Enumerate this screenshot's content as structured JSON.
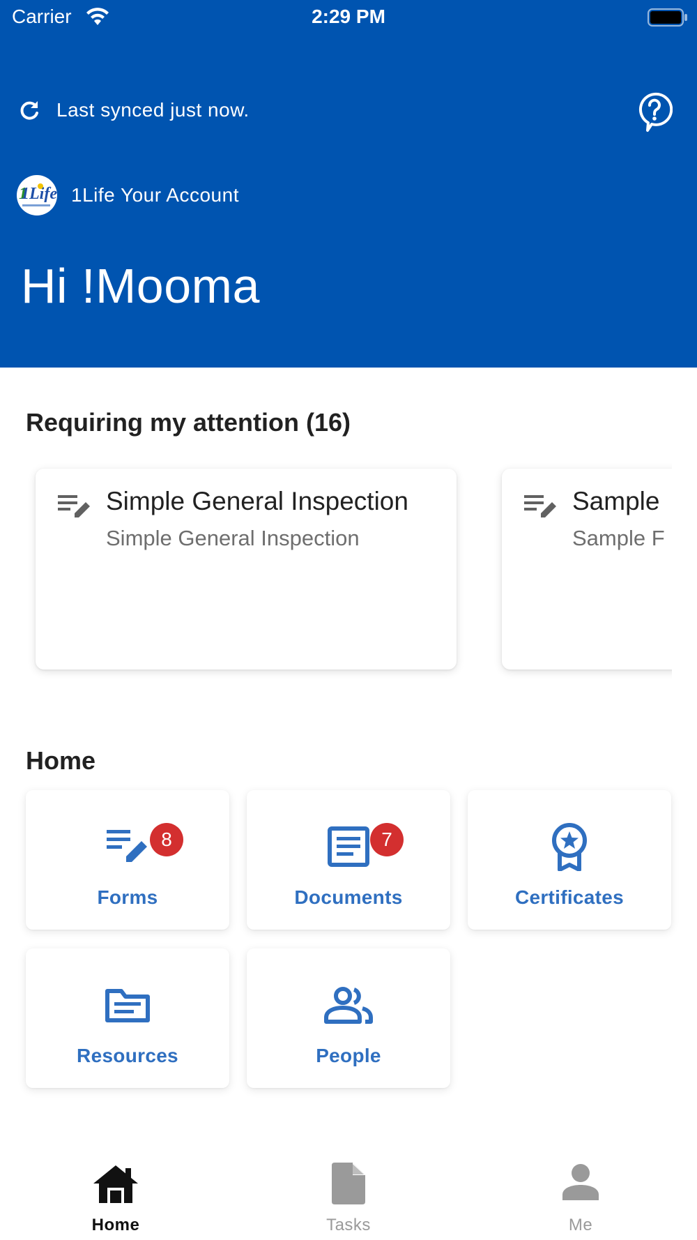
{
  "status_bar": {
    "carrier": "Carrier",
    "time": "2:29 PM"
  },
  "header": {
    "sync_text": "Last synced just now.",
    "account_logo_text": "1Life",
    "account_name": "1Life Your Account",
    "greeting": "Hi !Mooma",
    "background_color": "#0054B0",
    "icons": {
      "sync": "refresh-icon",
      "help": "help-bubble-icon"
    }
  },
  "attention": {
    "title": "Requiring my attention (16)",
    "cards": [
      {
        "title": "Simple General Inspection",
        "subtitle": "Simple General Inspection",
        "icon": "form-edit-icon"
      },
      {
        "title": "Sample",
        "subtitle": "Sample F",
        "icon": "form-edit-icon"
      }
    ]
  },
  "home": {
    "title": "Home",
    "accent_color": "#2F6FC0",
    "badge_color": "#D32F2F",
    "tiles": [
      {
        "label": "Forms",
        "badge": "8",
        "icon": "form-edit-icon"
      },
      {
        "label": "Documents",
        "badge": "7",
        "icon": "document-icon"
      },
      {
        "label": "Certificates",
        "icon": "certificate-icon"
      },
      {
        "label": "Resources",
        "icon": "folder-icon"
      },
      {
        "label": "People",
        "icon": "people-icon"
      }
    ]
  },
  "tabbar": {
    "tabs": [
      {
        "label": "Home",
        "icon": "home-icon",
        "active": true
      },
      {
        "label": "Tasks",
        "icon": "file-icon",
        "active": false
      },
      {
        "label": "Me",
        "icon": "person-icon",
        "active": false
      }
    ]
  }
}
